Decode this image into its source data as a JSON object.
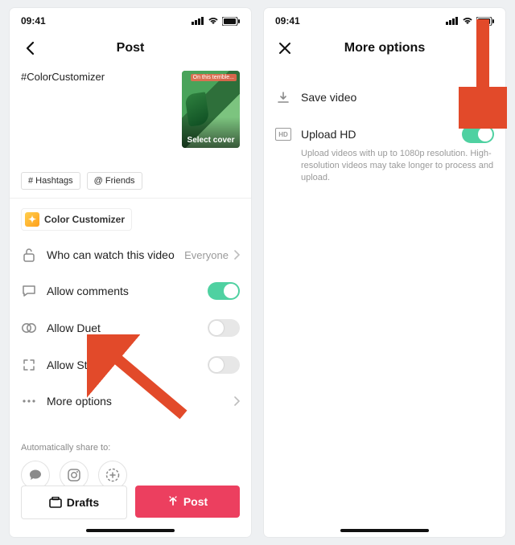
{
  "status": {
    "time": "09:41"
  },
  "post_screen": {
    "title": "Post",
    "caption": "#ColorCustomizer",
    "thumb": {
      "tag": "On this terrible...",
      "cover_label": "Select cover"
    },
    "chips": {
      "hashtags": "# Hashtags",
      "friends": "@ Friends"
    },
    "effect_pill": "Color Customizer",
    "rows": {
      "privacy": {
        "label": "Who can watch this video",
        "value": "Everyone"
      },
      "comments": {
        "label": "Allow comments",
        "on": true
      },
      "duet": {
        "label": "Allow Duet",
        "on": false
      },
      "stitch": {
        "label": "Allow Stitch",
        "on": false
      },
      "more": {
        "label": "More options"
      }
    },
    "share_label": "Automatically share to:",
    "buttons": {
      "drafts": "Drafts",
      "post": "Post"
    }
  },
  "more_screen": {
    "title": "More options",
    "save": {
      "label": "Save video"
    },
    "upload_hd": {
      "label": "Upload HD",
      "on": true,
      "hint": "Upload videos with up to 1080p resolution. High-resolution videos may take longer to process and upload.",
      "hd_badge": "HD"
    }
  }
}
